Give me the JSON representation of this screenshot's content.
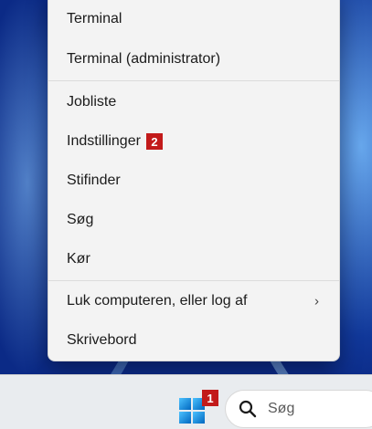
{
  "menu": {
    "items": [
      {
        "label": "Terminal"
      },
      {
        "label": "Terminal (administrator)"
      },
      {
        "label": "Jobliste"
      },
      {
        "label": "Indstillinger",
        "badge": "2"
      },
      {
        "label": "Stifinder"
      },
      {
        "label": "Søg"
      },
      {
        "label": "Kør"
      },
      {
        "label": "Luk computeren, eller log af",
        "submenu_arrow": "›"
      },
      {
        "label": "Skrivebord"
      }
    ]
  },
  "taskbar": {
    "start_badge": "1",
    "search_placeholder": "Søg",
    "icons": [
      "windows-logo-icon",
      "search-icon"
    ]
  },
  "colors": {
    "badge": "#c21a1a",
    "menu_bg": "#f3f3f3",
    "taskbar_bg": "#e9ecef",
    "windows_accent": "#0067c0"
  }
}
